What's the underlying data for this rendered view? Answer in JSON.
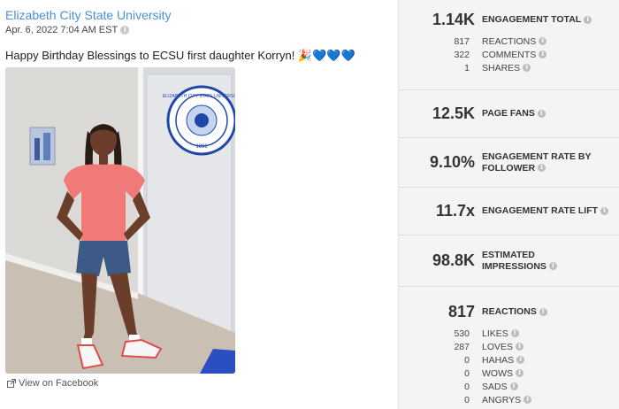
{
  "post": {
    "author": "Elizabeth City State University",
    "date": "Apr. 6, 2022 7:04 AM EST",
    "message": "Happy Birthday Blessings to ECSU first daughter Korryn! 🎉💙💙💙",
    "view_link": "View on Facebook",
    "seal_text": "ELIZABETH CITY STATE UNIVERSITY",
    "seal_year": "1891"
  },
  "metrics": {
    "engagement_total": {
      "value": "1.14K",
      "label": "ENGAGEMENT TOTAL"
    },
    "engagement_breakdown": [
      {
        "count": "817",
        "label": "REACTIONS"
      },
      {
        "count": "322",
        "label": "COMMENTS"
      },
      {
        "count": "1",
        "label": "SHARES"
      }
    ],
    "page_fans": {
      "value": "12.5K",
      "label": "PAGE FANS"
    },
    "engagement_rate": {
      "value": "9.10%",
      "label_line1": "ENGAGEMENT RATE BY",
      "label_line2": "FOLLOWER"
    },
    "engagement_lift": {
      "value": "11.7x",
      "label": "ENGAGEMENT RATE LIFT"
    },
    "impressions": {
      "value": "98.8K",
      "label_line1": "ESTIMATED",
      "label_line2": "IMPRESSIONS"
    },
    "reactions": {
      "value": "817",
      "label": "REACTIONS"
    },
    "reaction_breakdown": [
      {
        "count": "530",
        "label": "LIKES"
      },
      {
        "count": "287",
        "label": "LOVES"
      },
      {
        "count": "0",
        "label": "HAHAS"
      },
      {
        "count": "0",
        "label": "WOWS"
      },
      {
        "count": "0",
        "label": "SADS"
      },
      {
        "count": "0",
        "label": "ANGRYS"
      }
    ]
  },
  "icons": {
    "info": "info-icon",
    "external_link": "external-link-icon"
  }
}
